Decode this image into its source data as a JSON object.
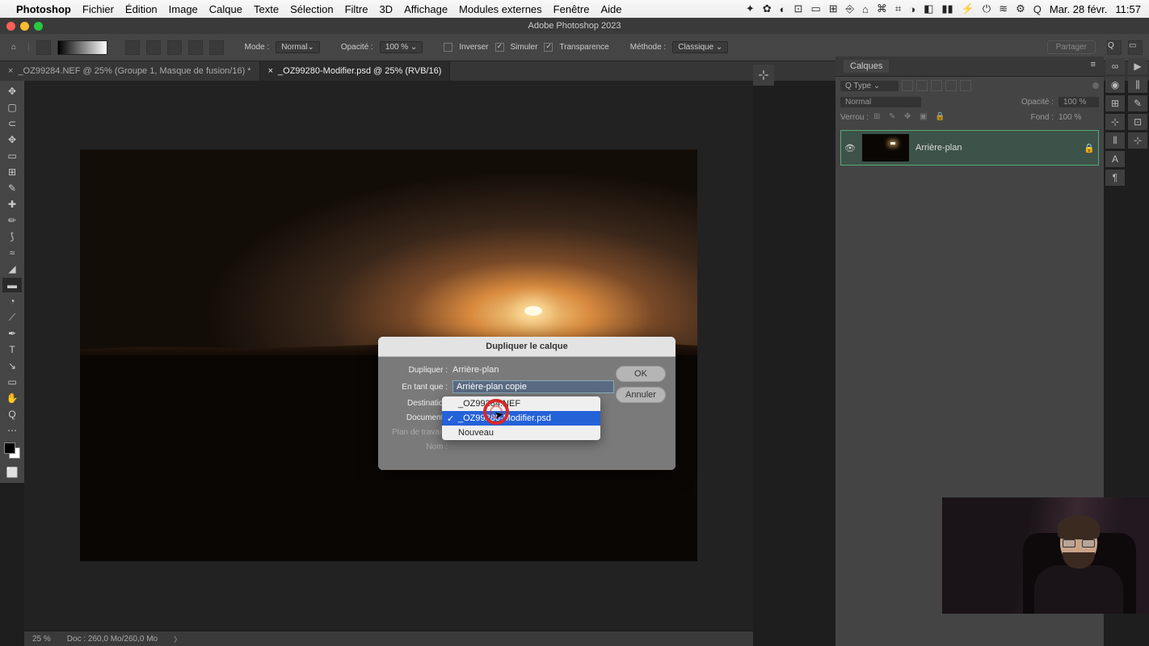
{
  "menubar": {
    "app": "Photoshop",
    "items": [
      "Fichier",
      "Édition",
      "Image",
      "Calque",
      "Texte",
      "Sélection",
      "Filtre",
      "3D",
      "Affichage",
      "Modules externes",
      "Fenêtre",
      "Aide"
    ],
    "right_icons": [
      "✦",
      "✿",
      "◐",
      "◑",
      "▭",
      "⊡",
      "⊞",
      "⎋",
      "⌂",
      "⌘",
      "⌗",
      "⌬",
      "⌂",
      "◧",
      "≡",
      "⚡",
      "⏻",
      "≋",
      "✦",
      "⚙",
      "Q"
    ],
    "date": "Mar. 28 févr.",
    "time": "11:57"
  },
  "window": {
    "title": "Adobe Photoshop 2023"
  },
  "optionsbar": {
    "mode_label": "Mode :",
    "mode_value": "Normal",
    "opacity_label": "Opacité :",
    "opacity_value": "100 %",
    "inverser": "Inverser",
    "simuler": "Simuler",
    "transparence": "Transparence",
    "methode_label": "Méthode :",
    "methode_value": "Classique",
    "share": "Partager"
  },
  "tabs": [
    {
      "label": "_OZ99284.NEF @ 25% (Groupe 1, Masque de fusion/16) *",
      "active": false
    },
    {
      "label": "_OZ99280-Modifier.psd @ 25% (RVB/16)",
      "active": true
    }
  ],
  "tools": [
    "↖",
    "▢",
    "⊞",
    "✥",
    "▭",
    "✎",
    "✚",
    "⟳",
    "◢",
    "✏",
    "⟆",
    "≈",
    "◔",
    "⟋",
    "◢",
    "⬛",
    "✒",
    "▲",
    "◯",
    "T",
    "↘",
    "✦",
    "…",
    "⬜",
    "Q"
  ],
  "status": {
    "zoom": "25 %",
    "doc": "Doc : 260,0 Mo/260,0 Mo"
  },
  "dialog": {
    "title": "Dupliquer le calque",
    "dup_label": "Dupliquer :",
    "dup_value": "Arrière-plan",
    "as_label": "En tant que :",
    "as_value": "Arrière-plan copie",
    "dest_label": "Destination",
    "doc_label": "Document :",
    "plan_label": "Plan de travail :",
    "nom_label": "Nom :",
    "ok": "OK",
    "cancel": "Annuler",
    "dropdown": {
      "options": [
        {
          "label": "_OZ99284.NEF",
          "selected": false,
          "checked": false
        },
        {
          "label": "_OZ99280-Modifier.psd",
          "selected": true,
          "checked": true
        },
        {
          "label": "Nouveau",
          "selected": false,
          "checked": false
        }
      ]
    }
  },
  "layers_panel": {
    "title": "Calques",
    "type_label": "Type",
    "mode": "Normal",
    "opacity_label": "Opacité :",
    "opacity_value": "100 %",
    "lock_label": "Verrou :",
    "fill_label": "Fond :",
    "fill_value": "100 %",
    "layer_name": "Arrière-plan"
  }
}
